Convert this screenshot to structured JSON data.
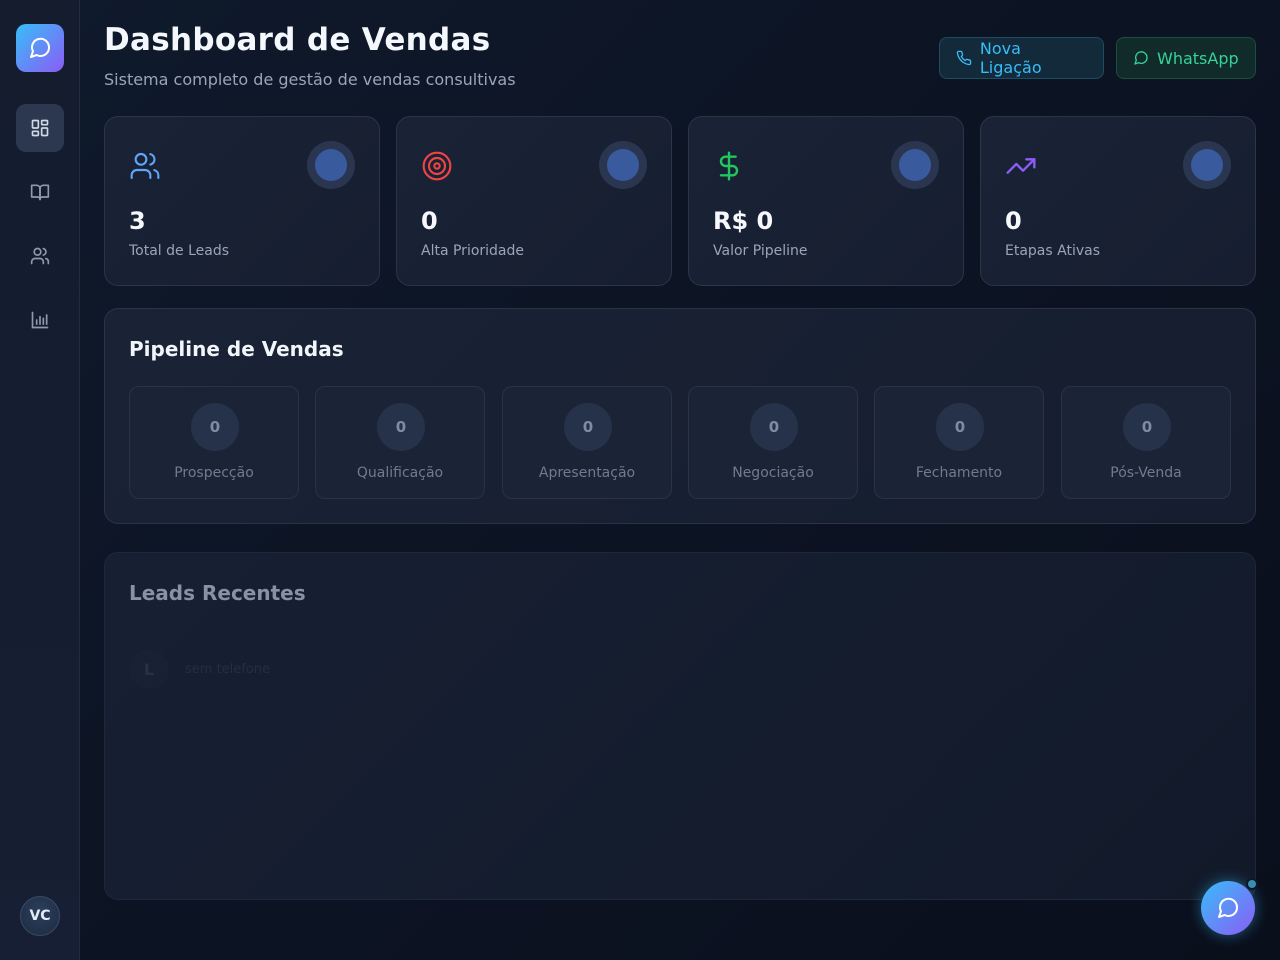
{
  "header": {
    "title": "Dashboard de Vendas",
    "subtitle": "Sistema completo de gestão de vendas consultivas",
    "call_button": "Nova Ligação",
    "whatsapp_button": "WhatsApp"
  },
  "sidebar": {
    "items": [
      {
        "icon": "dashboard-icon",
        "active": true
      },
      {
        "icon": "book-icon",
        "active": false
      },
      {
        "icon": "users-icon",
        "active": false
      },
      {
        "icon": "bar-chart-icon",
        "active": false
      }
    ],
    "avatar_initials": "VC"
  },
  "stats": [
    {
      "value": "3",
      "label": "Total de Leads",
      "icon": "users-icon",
      "color": "#60a5fa"
    },
    {
      "value": "0",
      "label": "Alta Prioridade",
      "icon": "target-icon",
      "color": "#ef4444"
    },
    {
      "value": "R$ 0",
      "label": "Valor Pipeline",
      "icon": "dollar-icon",
      "color": "#22c55e"
    },
    {
      "value": "0",
      "label": "Etapas Ativas",
      "icon": "trending-up-icon",
      "color": "#8b5cf6"
    }
  ],
  "pipeline": {
    "title": "Pipeline de Vendas",
    "stages": [
      {
        "count": "0",
        "name": "Prospecção"
      },
      {
        "count": "0",
        "name": "Qualificação"
      },
      {
        "count": "0",
        "name": "Apresentação"
      },
      {
        "count": "0",
        "name": "Negociação"
      },
      {
        "count": "0",
        "name": "Fechamento"
      },
      {
        "count": "0",
        "name": "Pós-Venda"
      }
    ]
  },
  "leads": {
    "title": "Leads Recentes",
    "placeholder_row": {
      "initial": "L",
      "text": "sem telefone"
    }
  },
  "colors": {
    "accent_cyan": "#38bdf8",
    "accent_purple": "#8b5cf6",
    "whatsapp_green": "#34d399"
  }
}
